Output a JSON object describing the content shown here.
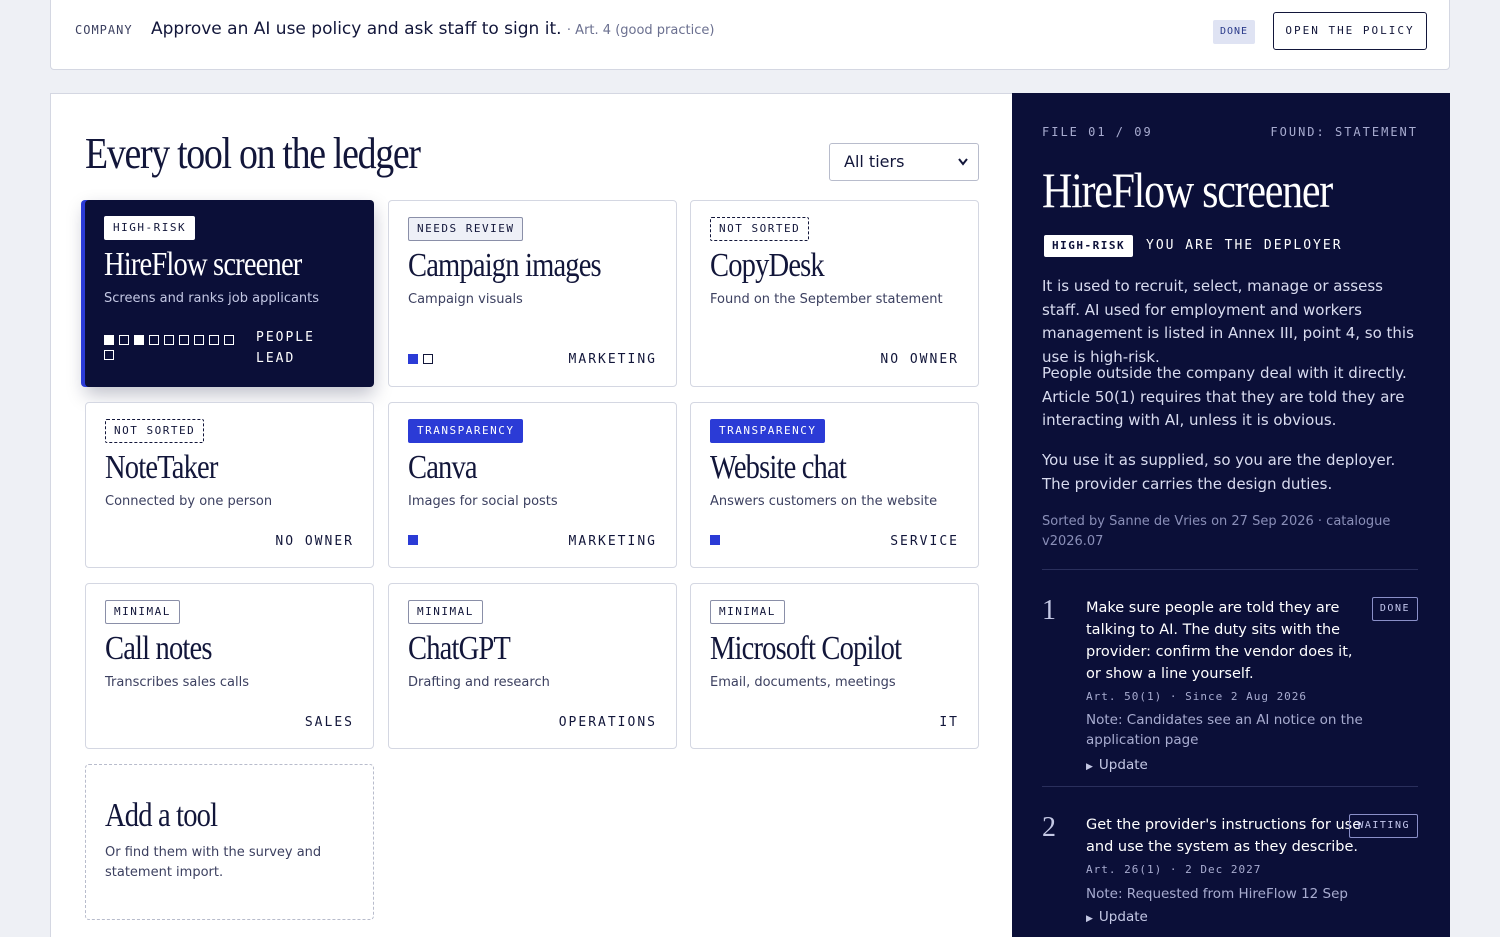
{
  "policy": {
    "scope": "COMPANY",
    "text": "Approve an AI use policy and ask staff to sign it.",
    "article": "· Art. 4 (good practice)",
    "status": "DONE",
    "action": "OPEN THE POLICY"
  },
  "ledger": {
    "title": "Every tool on the ledger",
    "filter_value": "All tiers",
    "tools": [
      {
        "tag": "HIGH-RISK",
        "name": "HireFlow screener",
        "desc": "Screens and ranks job applicants",
        "owner": "PEOPLE\nLEAD",
        "pips_on": 2,
        "pips_total": 10
      },
      {
        "tag": "NEEDS REVIEW",
        "name": "Campaign images",
        "desc": "Campaign visuals",
        "owner": "MARKETING",
        "pips_on": 1,
        "pips_total": 2
      },
      {
        "tag": "NOT SORTED",
        "name": "CopyDesk",
        "desc": "Found on the September statement",
        "owner": "NO OWNER"
      },
      {
        "tag": "NOT SORTED",
        "name": "NoteTaker",
        "desc": "Connected by one person",
        "owner": "NO OWNER"
      },
      {
        "tag": "TRANSPARENCY",
        "name": "Canva",
        "desc": "Images for social posts",
        "owner": "MARKETING",
        "pips_on": 1,
        "pips_total": 1
      },
      {
        "tag": "TRANSPARENCY",
        "name": "Website chat",
        "desc": "Answers customers on the website",
        "owner": "SERVICE",
        "pips_on": 1,
        "pips_total": 1
      },
      {
        "tag": "MINIMAL",
        "name": "Call notes",
        "desc": "Transcribes sales calls",
        "owner": "SALES"
      },
      {
        "tag": "MINIMAL",
        "name": "ChatGPT",
        "desc": "Drafting and research",
        "owner": "OPERATIONS"
      },
      {
        "tag": "MINIMAL",
        "name": "Microsoft Copilot",
        "desc": "Email, documents, meetings",
        "owner": "IT"
      }
    ],
    "add": {
      "title": "Add a tool",
      "desc": "Or find them with the survey and statement import."
    }
  },
  "detail": {
    "file": "FILE 01 / 09",
    "found": "FOUND: STATEMENT",
    "title": "HireFlow screener",
    "tier": "HIGH-RISK",
    "role": "YOU ARE THE DEPLOYER",
    "paragraphs": [
      "It is used to recruit, select, manage or assess staff. AI used for employment and workers management is listed in Annex III, point 4, so this use is high-risk.",
      "People outside the company deal with it directly. Article 50(1) requires that they are told they are interacting with AI, unless it is obvious.",
      "You use it as supplied, so you are the deployer. The provider carries the design duties."
    ],
    "sorted_by": "Sorted by Sanne de Vries on 27 Sep 2026 · catalogue v2026.07",
    "steps": [
      {
        "num": "1",
        "text": "Make sure people are told they are talking to AI. The duty sits with the provider: confirm the vendor does it, or show a line yourself.",
        "status": "DONE",
        "article": "Art. 50(1) · Since 2 Aug 2026",
        "note": "Note: Candidates see an AI notice on the application page",
        "update": "Update"
      },
      {
        "num": "2",
        "text": "Get the provider's instructions for use and use the system as they describe.",
        "status": "WAITING",
        "article": "Art. 26(1) · 2 Dec 2027",
        "note": "Note: Requested from HireFlow 12 Sep",
        "update": "Update"
      }
    ]
  },
  "colors": {
    "navy": "#0b0f38",
    "accent": "#2b3bd6",
    "background": "#eef0f5"
  }
}
